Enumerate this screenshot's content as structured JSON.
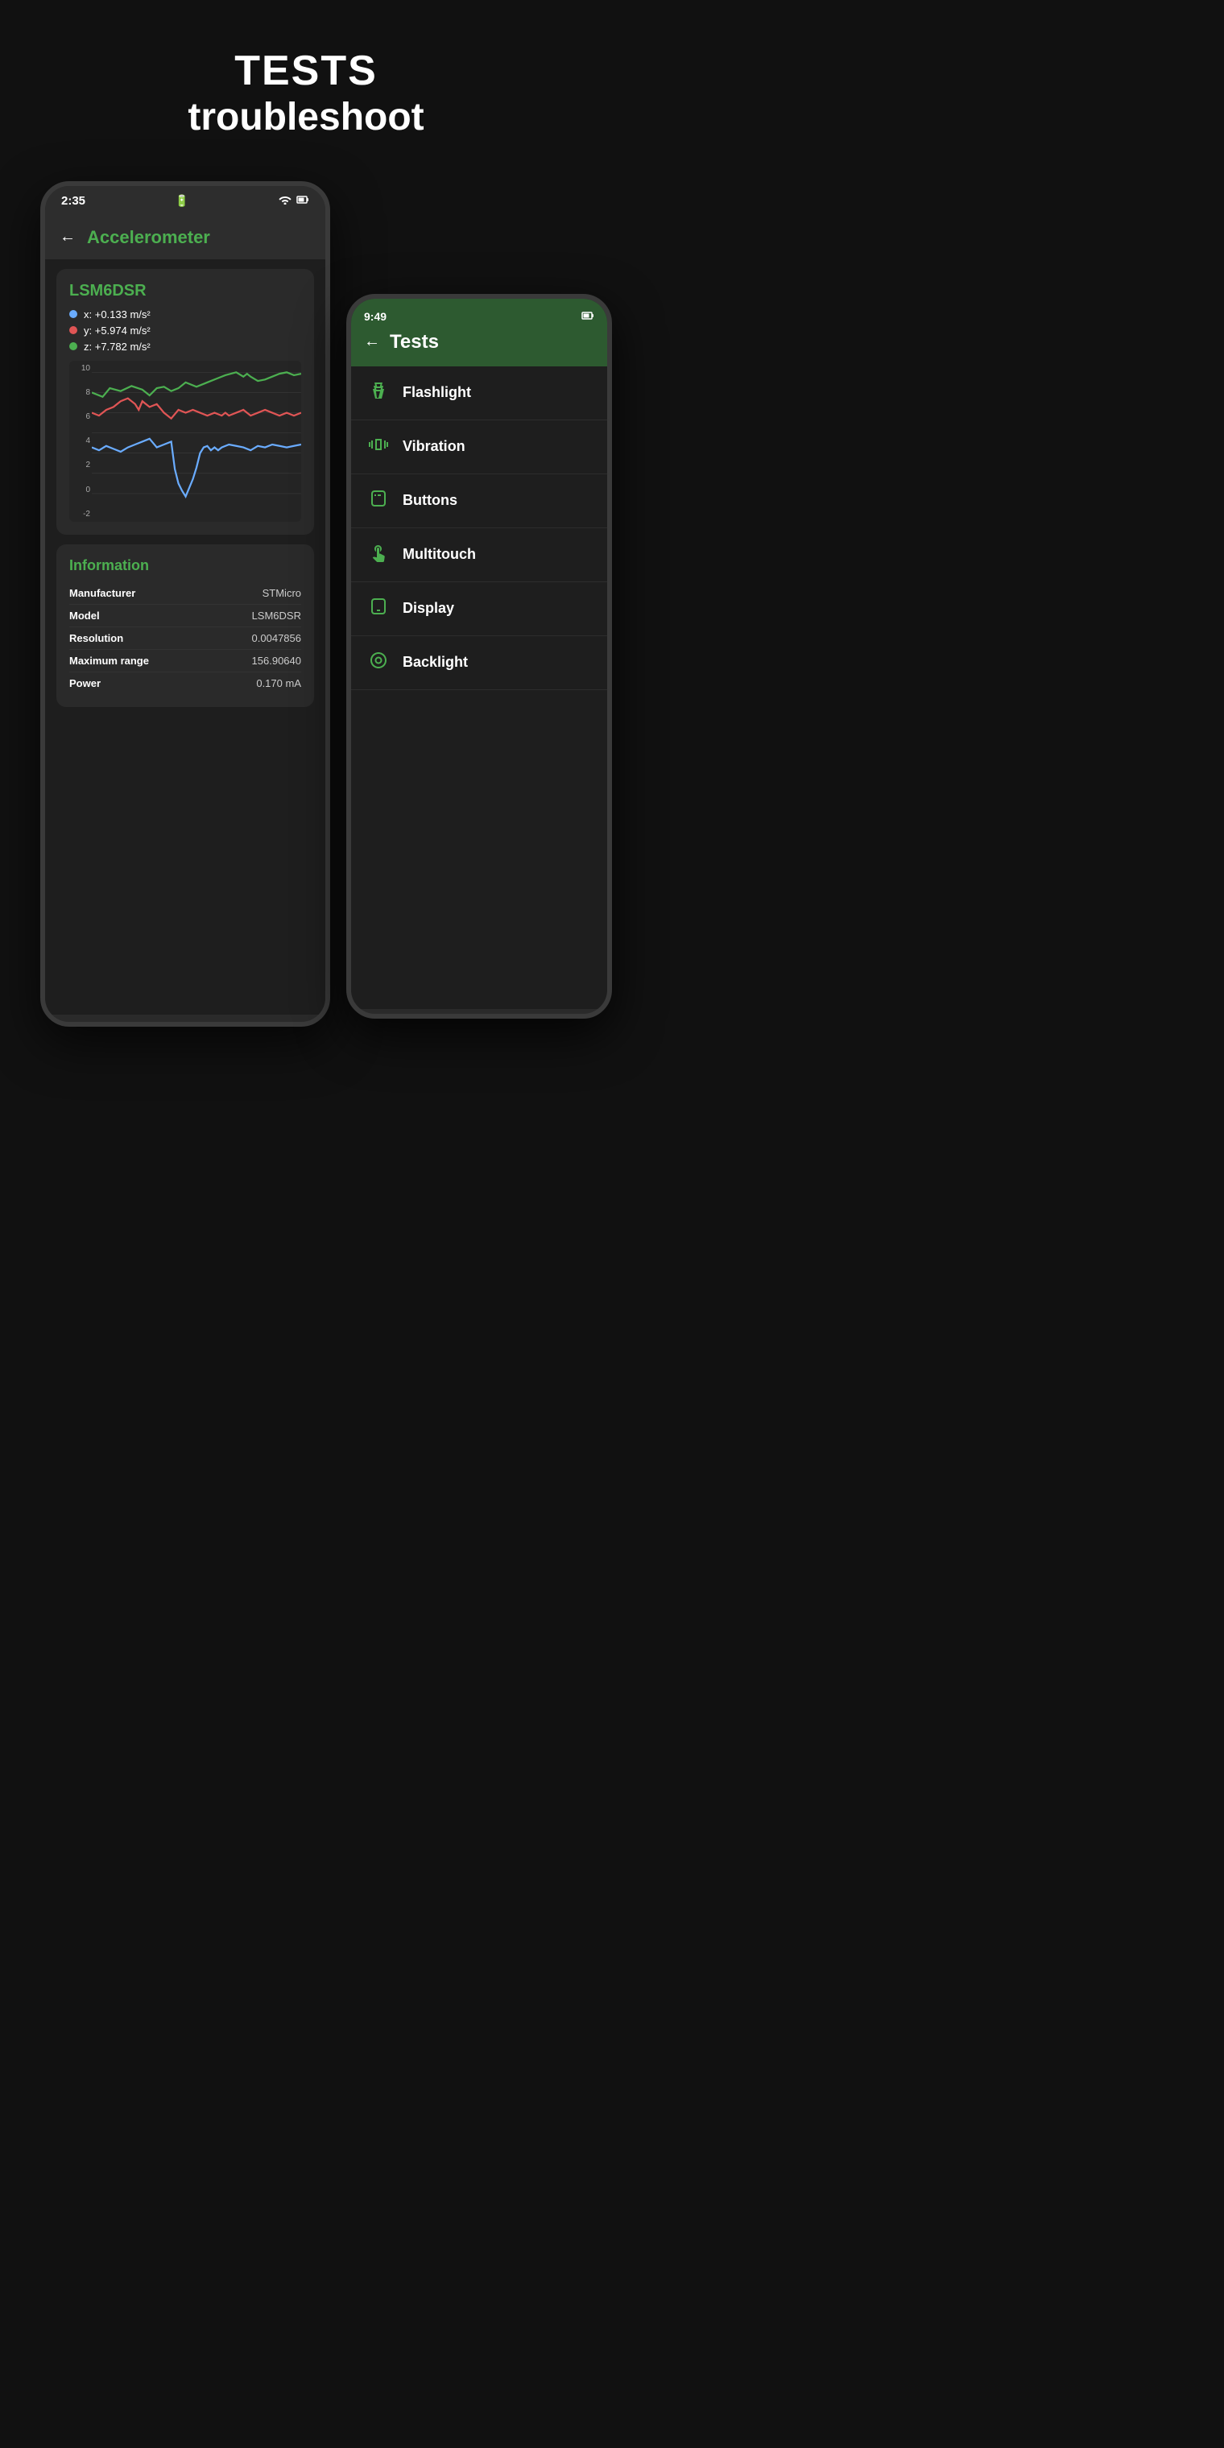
{
  "header": {
    "line1": "TESTS",
    "line2": "troubleshoot"
  },
  "phone_left": {
    "status_bar": {
      "time": "2:35",
      "battery_icon": "🔋",
      "wifi_icon": "WiFi",
      "battery2": "🔋"
    },
    "app_bar": {
      "title": "Accelerometer"
    },
    "sensor_card": {
      "title": "LSM6DSR",
      "x_value": "x: +0.133 m/s²",
      "y_value": "y: +5.974 m/s²",
      "z_value": "z: +7.782 m/s²",
      "x_color": "#6aacff",
      "y_color": "#e05555",
      "z_color": "#4caf50"
    },
    "info_card": {
      "title": "Information",
      "rows": [
        {
          "label": "Manufacturer",
          "value": "STMicro"
        },
        {
          "label": "Model",
          "value": "LSM6DSR"
        },
        {
          "label": "Resolution",
          "value": "0.0047856"
        },
        {
          "label": "Maximum range",
          "value": "156.90640"
        },
        {
          "label": "Power",
          "value": "0.170 mA"
        }
      ]
    }
  },
  "phone_right": {
    "status_bar": {
      "time": "9:49",
      "battery_icon": "🔋"
    },
    "app_bar": {
      "title": "Tests"
    },
    "test_items": [
      {
        "label": "Flashlight",
        "icon": "flashlight"
      },
      {
        "label": "Vibration",
        "icon": "vibration"
      },
      {
        "label": "Buttons",
        "icon": "buttons"
      },
      {
        "label": "Multitouch",
        "icon": "multitouch"
      },
      {
        "label": "Display",
        "icon": "display"
      },
      {
        "label": "Backlight",
        "icon": "backlight"
      }
    ]
  }
}
